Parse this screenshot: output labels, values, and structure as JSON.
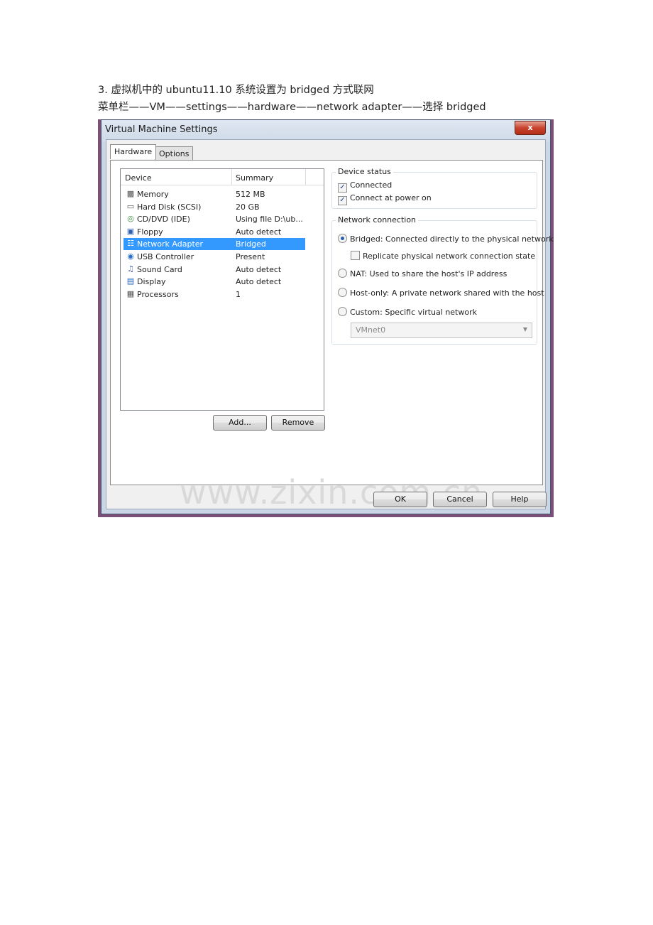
{
  "doc": {
    "line1": "3.  虚拟机中的 ubuntu11.10 系统设置为 bridged 方式联网",
    "line2": "菜单栏——VM——settings——hardware——network adapter——选择 bridged"
  },
  "dialog": {
    "title": "Virtual Machine Settings",
    "close_label": "x",
    "tabs": [
      {
        "label": "Hardware"
      },
      {
        "label": "Options"
      }
    ],
    "list": {
      "col_device": "Device",
      "col_summary": "Summary",
      "rows": [
        {
          "icon": "memory-icon",
          "device": "Memory",
          "summary": "512 MB"
        },
        {
          "icon": "hard-disk-icon",
          "device": "Hard Disk (SCSI)",
          "summary": "20 GB"
        },
        {
          "icon": "cd-dvd-icon",
          "device": "CD/DVD (IDE)",
          "summary": "Using file D:\\ub..."
        },
        {
          "icon": "floppy-icon",
          "device": "Floppy",
          "summary": "Auto detect"
        },
        {
          "icon": "network-adapter-icon",
          "device": "Network Adapter",
          "summary": "Bridged"
        },
        {
          "icon": "usb-icon",
          "device": "USB Controller",
          "summary": "Present"
        },
        {
          "icon": "sound-card-icon",
          "device": "Sound Card",
          "summary": "Auto detect"
        },
        {
          "icon": "display-icon",
          "device": "Display",
          "summary": "Auto detect"
        },
        {
          "icon": "processor-icon",
          "device": "Processors",
          "summary": "1"
        }
      ],
      "selected_index": 4
    },
    "add_label": "Add...",
    "remove_label": "Remove",
    "device_status": {
      "label": "Device status",
      "connected": "Connected",
      "connect_power_on": "Connect at power on"
    },
    "network_connection": {
      "label": "Network connection",
      "bridged": "Bridged: Connected directly to the physical network",
      "replicate": "Replicate physical network connection state",
      "nat": "NAT: Used to share the host's IP address",
      "host_only": "Host-only: A private network shared with the host",
      "custom": "Custom: Specific virtual network",
      "vmnet_value": "VMnet0"
    },
    "ok_label": "OK",
    "cancel_label": "Cancel",
    "help_label": "Help"
  },
  "watermark": "www.zixin.com.cn"
}
